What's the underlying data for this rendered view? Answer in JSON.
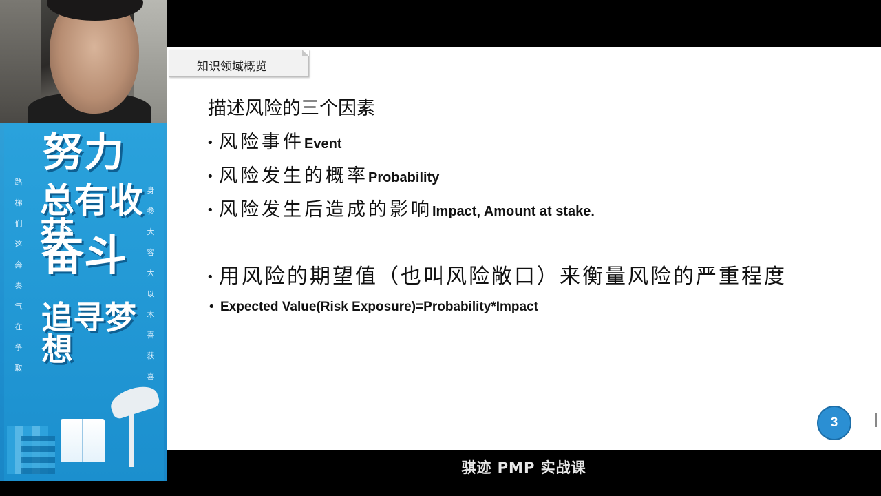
{
  "sidebar": {
    "poster": {
      "line1": "努力",
      "line2": "总有收获",
      "line3": "奋斗",
      "line4": "追寻梦想",
      "left_column": [
        "路",
        "梯",
        "们",
        "这",
        "奔",
        "奏",
        "气",
        "在",
        "争",
        "取"
      ],
      "right_column": [
        "身",
        "参",
        "大",
        "容",
        "大",
        "以",
        "木",
        "喜",
        "获",
        "喜"
      ]
    }
  },
  "slide": {
    "section_tab": "知识领域概览",
    "heading": "描述风险的三个因素",
    "bullets": [
      {
        "cn": "风险事件",
        "en": "Event"
      },
      {
        "cn": "风险发生的概率",
        "en": "Probability"
      },
      {
        "cn": "风险发生后造成的影响",
        "en": "Impact, Amount at stake."
      },
      {
        "cn": "用风险的期望值（也叫风险敞口）来衡量风险的严重程度",
        "en": ""
      },
      {
        "cn": "",
        "en": "Expected Value(Risk Exposure)=Probability*Impact"
      }
    ],
    "page_number": "3"
  },
  "footer": {
    "caption": "骐迹 PMP 实战课"
  }
}
